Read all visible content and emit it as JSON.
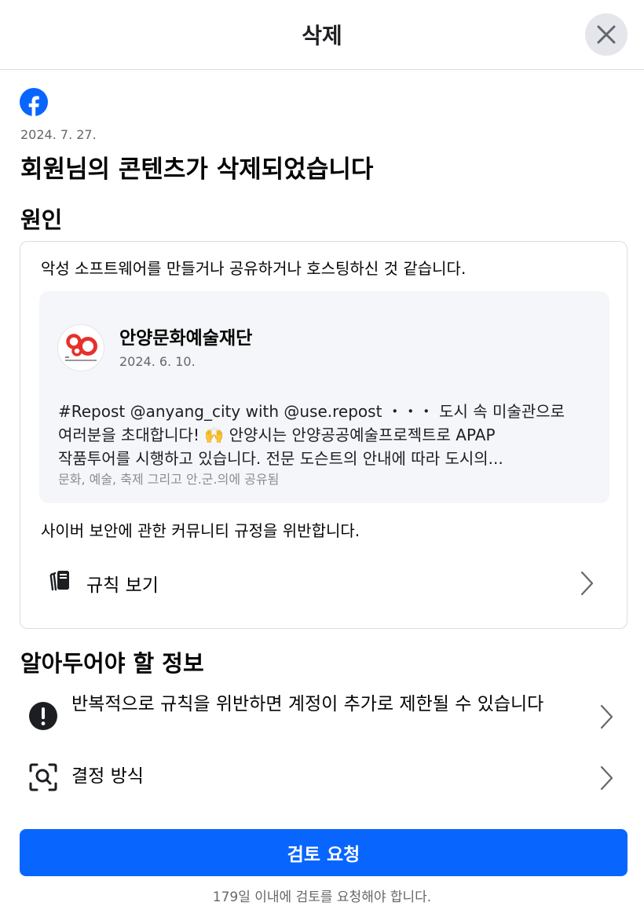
{
  "header": {
    "title": "삭제"
  },
  "notice": {
    "date": "2024. 7. 27.",
    "title": "회원님의 콘텐츠가 삭제되었습니다"
  },
  "reason": {
    "heading": "원인",
    "text": "악성 소프트웨어를 만들거나 공유하거나 호스팅하신 것 같습니다.",
    "post": {
      "author": "안양문화예술재단",
      "date": "2024. 6. 10.",
      "body_lines": [
        "#Repost @anyang_city with @use.repost ・・・ 도시 속 미술관으로",
        "여러분을 초대합니다! 🙌 안양시는 안양공공예술프로젝트로 APAP",
        "작품투어를 시행하고 있습니다. 전문 도슨트의 안내에 따라 도시의..."
      ],
      "shared_text": "문화, 예술, 축제 그리고 안.군.의에 공유됨"
    },
    "violation": "사이버 보안에 관한 커뮤니티 규정을 위반합니다.",
    "rules_link": "규칙 보기"
  },
  "info": {
    "heading": "알아두어야 할 정보",
    "items": [
      {
        "label": "반복적으로 규칙을 위반하면 계정이 추가로 제한될 수 있습니다",
        "icon": "exclamation-icon"
      },
      {
        "label": "결정 방식",
        "icon": "search-scan-icon"
      }
    ]
  },
  "footer": {
    "review_button": "검토 요청",
    "deadline": "179일 이내에 검토를 요청해야 합니다."
  },
  "colors": {
    "primary": "#0866ff",
    "secondary_text": "#65676b",
    "card_bg": "#f5f6f9",
    "border": "#dadde1"
  }
}
